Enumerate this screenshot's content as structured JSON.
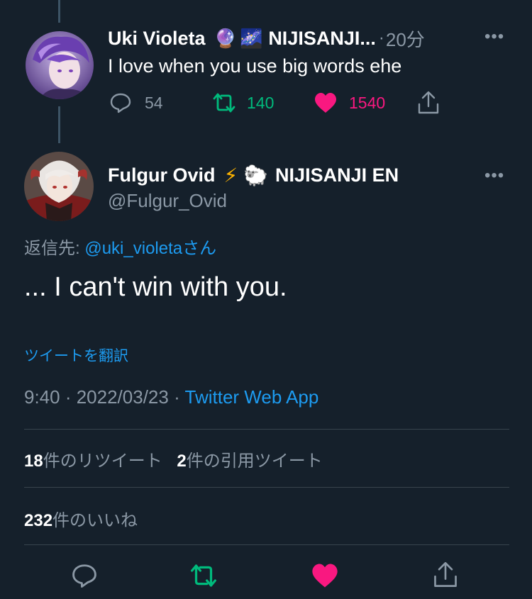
{
  "parent_tweet": {
    "display_name": "Uki Violeta",
    "emoji_1": "🔮",
    "emoji_2": "🌌",
    "affiliation": "NIJISANJI...",
    "separator": "·",
    "time_ago": "20分",
    "text": "I love when you use big words ehe",
    "reply_count": "54",
    "retweet_count": "140",
    "like_count": "1540",
    "colors": {
      "retweet": "#00ba7c",
      "like": "#f91880"
    }
  },
  "main_tweet": {
    "display_name": "Fulgur Ovid",
    "emoji_1": "⚡",
    "emoji_2": "🐑",
    "affiliation": "NIJISANJI EN",
    "handle": "@Fulgur_Ovid",
    "reply_prefix": "返信先: ",
    "reply_handle": "@uki_violeta",
    "reply_suffix": "さん",
    "text": "... I can't win with you.",
    "translate_label": "ツイートを翻訳",
    "time": "9:40",
    "dot": " · ",
    "date": "2022/03/23",
    "source": "Twitter Web App"
  },
  "stats": {
    "retweets_num": "18",
    "retweets_label": "件のリツイート",
    "quotes_num": "2",
    "quotes_label": "件の引用ツイート",
    "likes_num": "232",
    "likes_label": "件のいいね"
  },
  "theme": {
    "background": "#15202b",
    "link": "#1d9bf0",
    "muted": "#8b98a5"
  },
  "icons": [
    "reply-icon",
    "retweet-icon",
    "like-icon",
    "share-icon",
    "more-icon"
  ]
}
